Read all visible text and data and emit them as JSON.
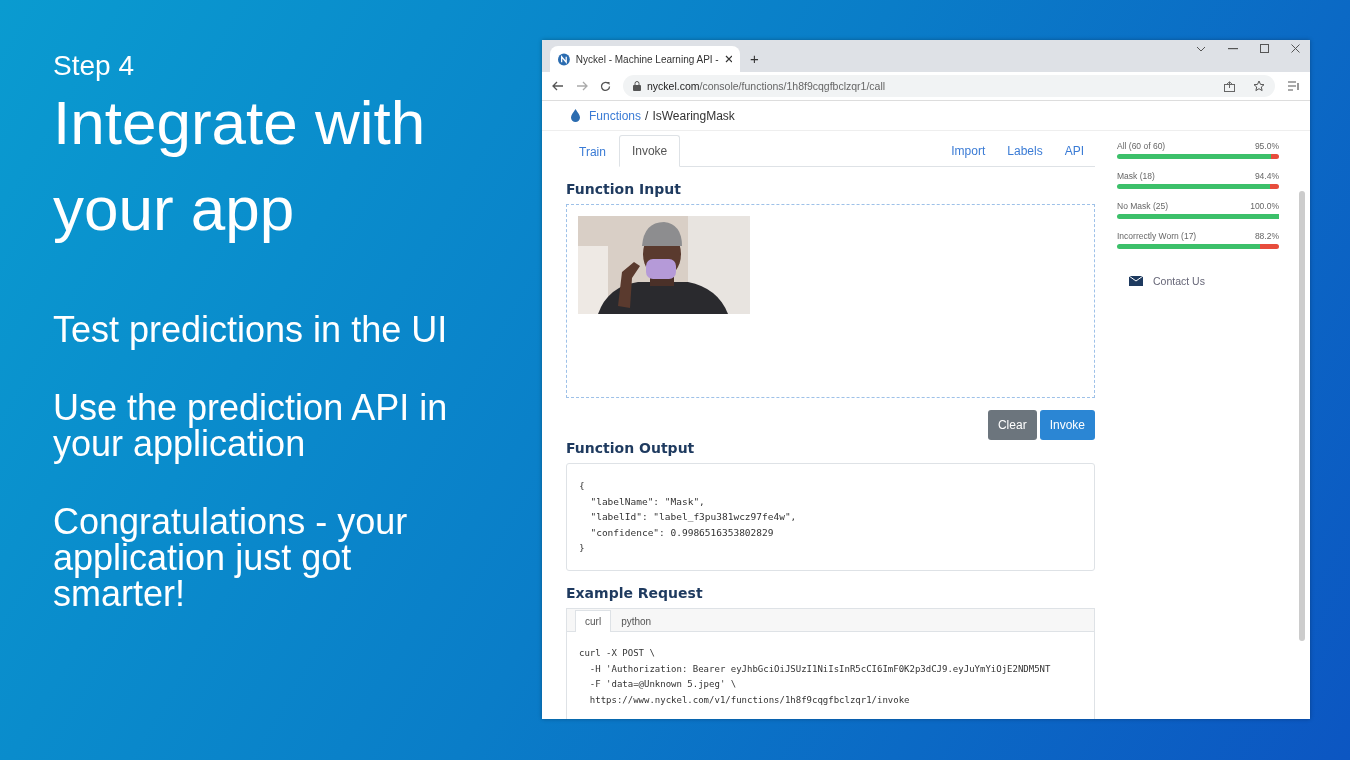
{
  "slide": {
    "step": "Step 4",
    "title": "Integrate with your app",
    "points": [
      "Test predictions in the UI",
      "Use the prediction API in your application",
      "Congratulations - your application just got smarter!"
    ]
  },
  "browser": {
    "tab_title": "Nyckel - Machine Learning API -",
    "new_tab": "+",
    "url_host": "nyckel.com",
    "url_path": "/console/functions/1h8f9cqgfbclzqr1/call"
  },
  "breadcrumb": {
    "link": "Functions",
    "separator": "/",
    "current": "IsWearingMask"
  },
  "tabs": [
    {
      "label": "Train",
      "selected": false
    },
    {
      "label": "Invoke",
      "selected": true
    }
  ],
  "links": [
    "Import",
    "Labels",
    "API"
  ],
  "input": {
    "heading": "Function Input"
  },
  "buttons": [
    {
      "label": "Clear",
      "kind": "secondary"
    },
    {
      "label": "Invoke",
      "kind": "primary"
    }
  ],
  "output": {
    "heading": "Function Output",
    "lines": [
      "{",
      "  \"labelName\": \"Mask\",",
      "  \"labelId\": \"label_f3pu381wcz97fe4w\",",
      "  \"confidence\": 0.9986516353802829",
      "}"
    ]
  },
  "example": {
    "heading": "Example Request",
    "tabs": [
      {
        "label": "curl",
        "selected": true
      },
      {
        "label": "python",
        "selected": false
      }
    ],
    "lines": [
      "curl -X POST \\",
      "  -H 'Authorization: Bearer eyJhbGciOiJSUzI1NiIsInR5cCI6ImF0K2p3dCJ9.eyJuYmYiOjE2NDM5NT",
      "  -F 'data=@Unknown 5.jpeg' \\",
      "  https://www.nyckel.com/v1/functions/1h8f9cqgfbclzqr1/invoke"
    ]
  },
  "stats": [
    {
      "label": "All (60 of 60)",
      "value": "95.0%",
      "level": 0.95
    },
    {
      "label": "Mask (18)",
      "value": "94.4%",
      "level": 0.944
    },
    {
      "label": "No Mask (25)",
      "value": "100.0%",
      "level": 1.0
    },
    {
      "label": "Incorrectly Worn (17)",
      "value": "88.2%",
      "level": 0.882
    }
  ],
  "contact": "Contact Us"
}
